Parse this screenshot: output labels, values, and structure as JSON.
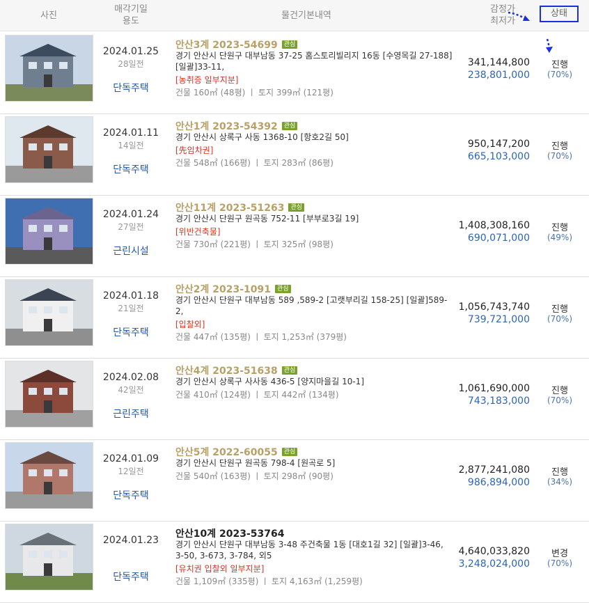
{
  "header": {
    "photo": "사진",
    "date_line1": "매각기일",
    "date_line2": "용도",
    "info": "물건기본내역",
    "price_line1": "감정가",
    "price_line2": "최저가",
    "status": "상태"
  },
  "colors": {
    "accent_box": "#1a2fe0",
    "case_gold": "#b9a066",
    "tag_green": "#7aa22b",
    "min_blue": "#2c64b8",
    "note_red": "#e0301e"
  },
  "rows": [
    {
      "date": "2024.01.25",
      "days": "28일전",
      "usage": "단독주택",
      "case": "안산3계 2023-54699",
      "tag": "관심",
      "addr": "경기 안산시 단원구 대부남동 37-25 홈스토리빌리지 16동 [수영목길 27-188] [일괄]33-11,",
      "note": "[농취증  일부지분]",
      "size": "건물 160㎡ (48평)   ㅣ  토지 399㎡ (121평)",
      "appraisal": "341,144,800",
      "minimum": "238,801,000",
      "status": "진행",
      "pct": "(70%)"
    },
    {
      "date": "2024.01.11",
      "days": "14일전",
      "usage": "단독주택",
      "case": "안산1계 2023-54392",
      "tag": "관심",
      "addr": "경기 안산시 상록구 사동 1368-10 [항호2길 50]",
      "note": "[先임차권]",
      "size": "건물 548㎡ (166평)   ㅣ  토지 283㎡ (86평)",
      "appraisal": "950,147,200",
      "minimum": "665,103,000",
      "status": "진행",
      "pct": "(70%)"
    },
    {
      "date": "2024.01.24",
      "days": "27일전",
      "usage": "근린시설",
      "case": "안산11계 2023-51263",
      "tag": "관심",
      "addr": "경기 안산시 단원구 원곡동 752-11 [부부로3길 19]",
      "note": "[위반건축물]",
      "size": "건물 730㎡ (221평)   ㅣ  토지 325㎡ (98평)",
      "appraisal": "1,408,308,160",
      "minimum": "690,071,000",
      "status": "진행",
      "pct": "(49%)"
    },
    {
      "date": "2024.01.18",
      "days": "21일전",
      "usage": "단독주택",
      "case": "안산2계 2023-1091",
      "tag": "관심",
      "addr": "경기 안산시 단원구 대부남동 589 ,589-2 [고랫부리길 158-25] [일괄]589-2,",
      "note": "[입찰외]",
      "size": "건물 447㎡ (135평)   ㅣ  토지 1,253㎡ (379평)",
      "appraisal": "1,056,743,740",
      "minimum": "739,721,000",
      "status": "진행",
      "pct": "(70%)"
    },
    {
      "date": "2024.02.08",
      "days": "42일전",
      "usage": "근린주택",
      "case": "안산4계 2023-51638",
      "tag": "관심",
      "addr": "경기 안산시 상록구 사사동 436-5 [양지마을길 10-1]",
      "note": "",
      "size": "건물 410㎡ (124평)   ㅣ  토지 442㎡ (134평)",
      "appraisal": "1,061,690,000",
      "minimum": "743,183,000",
      "status": "진행",
      "pct": "(70%)"
    },
    {
      "date": "2024.01.09",
      "days": "12일전",
      "usage": "단독주택",
      "case": "안산5계 2022-60055",
      "tag": "관심",
      "addr": "경기 안산시 단원구 원곡동 798-4 [원곡로 5]",
      "note": "",
      "size": "건물 540㎡ (163평)   ㅣ  토지 298㎡ (90평)",
      "appraisal": "2,877,241,080",
      "minimum": "986,894,000",
      "status": "진행",
      "pct": "(34%)"
    },
    {
      "date": "2024.01.23",
      "days": "",
      "usage": "단독주택",
      "case": "안산10계 2023-53764",
      "tag": "",
      "addr": "경기 안산시 단원구 대부남동 3-48 주건축물 1동 [대호1길 32] [일괄]3-46, 3-50, 3-673, 3-784, 외5",
      "note": "[유치권  입찰외  일부지분]",
      "size": "건물 1,109㎡ (335평)   ㅣ  토지 4,163㎡ (1,259평)",
      "appraisal": "4,640,033,820",
      "minimum": "3,248,024,000",
      "status": "변경",
      "pct": "(70%)"
    }
  ]
}
